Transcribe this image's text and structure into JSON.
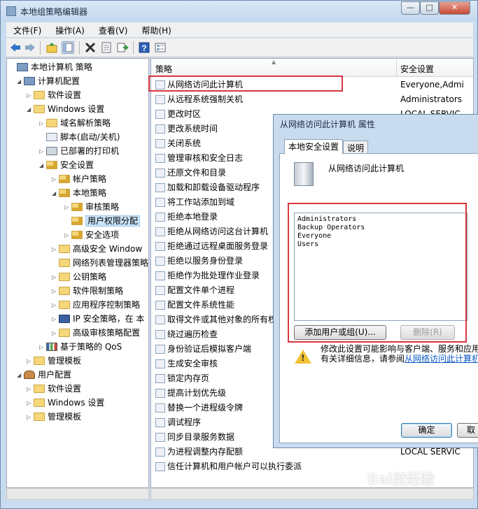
{
  "window": {
    "title": "本地组策略编辑器"
  },
  "menu": [
    "文件(F)",
    "操作(A)",
    "查看(V)",
    "帮助(H)"
  ],
  "tree": [
    {
      "label": "本地计算机 策略",
      "level": 0,
      "icon": "computer"
    },
    {
      "label": "计算机配置",
      "level": 1,
      "icon": "computer",
      "expanded": true
    },
    {
      "label": "软件设置",
      "level": 2,
      "icon": "folder",
      "expandable": true
    },
    {
      "label": "Windows 设置",
      "level": 2,
      "icon": "folder",
      "expanded": true
    },
    {
      "label": "域名解析策略",
      "level": 3,
      "icon": "folder",
      "expandable": true
    },
    {
      "label": "脚本(启动/关机)",
      "level": 3,
      "icon": "script"
    },
    {
      "label": "已部署的打印机",
      "level": 3,
      "icon": "printer",
      "expandable": true
    },
    {
      "label": "安全设置",
      "level": 3,
      "icon": "lock-folder",
      "expanded": true
    },
    {
      "label": "帐户策略",
      "level": 4,
      "icon": "lock-folder",
      "expandable": true
    },
    {
      "label": "本地策略",
      "level": 4,
      "icon": "lock-folder",
      "expanded": true
    },
    {
      "label": "审核策略",
      "level": 5,
      "icon": "lock-folder",
      "expandable": true
    },
    {
      "label": "用户权限分配",
      "level": 5,
      "icon": "lock-folder",
      "selected": true
    },
    {
      "label": "安全选项",
      "level": 5,
      "icon": "lock-folder",
      "expandable": true
    },
    {
      "label": "高级安全 Window",
      "level": 4,
      "icon": "folder",
      "expandable": true
    },
    {
      "label": "网络列表管理器策略",
      "level": 4,
      "icon": "folder"
    },
    {
      "label": "公钥策略",
      "level": 4,
      "icon": "folder",
      "expandable": true
    },
    {
      "label": "软件限制策略",
      "level": 4,
      "icon": "folder",
      "expandable": true
    },
    {
      "label": "应用程序控制策略",
      "level": 4,
      "icon": "folder",
      "expandable": true
    },
    {
      "label": "IP 安全策略，在 本",
      "level": 4,
      "icon": "shield",
      "expandable": true
    },
    {
      "label": "高级审核策略配置",
      "level": 4,
      "icon": "folder",
      "expandable": true
    },
    {
      "label": "基于策略的 QoS",
      "level": 3,
      "icon": "chart",
      "expandable": true
    },
    {
      "label": "管理模板",
      "level": 2,
      "icon": "folder",
      "expandable": true
    },
    {
      "label": "用户配置",
      "level": 1,
      "icon": "user",
      "expanded": true
    },
    {
      "label": "软件设置",
      "level": 2,
      "icon": "folder",
      "expandable": true
    },
    {
      "label": "Windows 设置",
      "level": 2,
      "icon": "folder",
      "expandable": true
    },
    {
      "label": "管理模板",
      "level": 2,
      "icon": "folder",
      "expandable": true
    }
  ],
  "list": {
    "headers": [
      "策略",
      "安全设置"
    ],
    "rows": [
      {
        "name": "从网络访问此计算机",
        "value": "Everyone,Admi"
      },
      {
        "name": "从远程系统强制关机",
        "value": "Administrators"
      },
      {
        "name": "更改时区",
        "value": "LOCAL SERVIC"
      },
      {
        "name": "更改系统时间",
        "value": ""
      },
      {
        "name": "关闭系统",
        "value": ""
      },
      {
        "name": "管理审核和安全日志",
        "value": ""
      },
      {
        "name": "还原文件和目录",
        "value": ""
      },
      {
        "name": "加载和卸载设备驱动程序",
        "value": ""
      },
      {
        "name": "将工作站添加到域",
        "value": ""
      },
      {
        "name": "拒绝本地登录",
        "value": ""
      },
      {
        "name": "拒绝从网络访问这台计算机",
        "value": ""
      },
      {
        "name": "拒绝通过远程桌面服务登录",
        "value": ""
      },
      {
        "name": "拒绝以服务身份登录",
        "value": ""
      },
      {
        "name": "拒绝作为批处理作业登录",
        "value": ""
      },
      {
        "name": "配置文件单个进程",
        "value": ""
      },
      {
        "name": "配置文件系统性能",
        "value": ""
      },
      {
        "name": "取得文件或其他对象的所有权",
        "value": ""
      },
      {
        "name": "绕过遍历检查",
        "value": ""
      },
      {
        "name": "身份验证后模拟客户端",
        "value": ""
      },
      {
        "name": "生成安全审核",
        "value": ""
      },
      {
        "name": "锁定内存页",
        "value": ""
      },
      {
        "name": "提高计划优先级",
        "value": ""
      },
      {
        "name": "替换一个进程级令牌",
        "value": ""
      },
      {
        "name": "调试程序",
        "value": ""
      },
      {
        "name": "同步目录服务数据",
        "value": ""
      },
      {
        "name": "为进程调整内存配额",
        "value": "LOCAL SERVIC"
      },
      {
        "name": "信任计算机和用户帐户可以执行委派",
        "value": ""
      }
    ]
  },
  "dialog": {
    "title": "从网络访问此计算机 属性",
    "tabs": [
      "本地安全设置",
      "说明"
    ],
    "policy_name": "从网络访问此计算机",
    "members": [
      "Administrators",
      "Backup Operators",
      "Everyone",
      "Users"
    ],
    "add_button": "添加用户或组(U)...",
    "remove_button": "删除(R)",
    "warning_line1": "修改此设置可能影响与客户端、服务和应用",
    "warning_line2_prefix": "有关详细信息，请参阅",
    "warning_link": "从网络访问此计算机",
    "ok_button": "确定",
    "cancel_button": "取"
  },
  "watermark": "Bai度经验"
}
